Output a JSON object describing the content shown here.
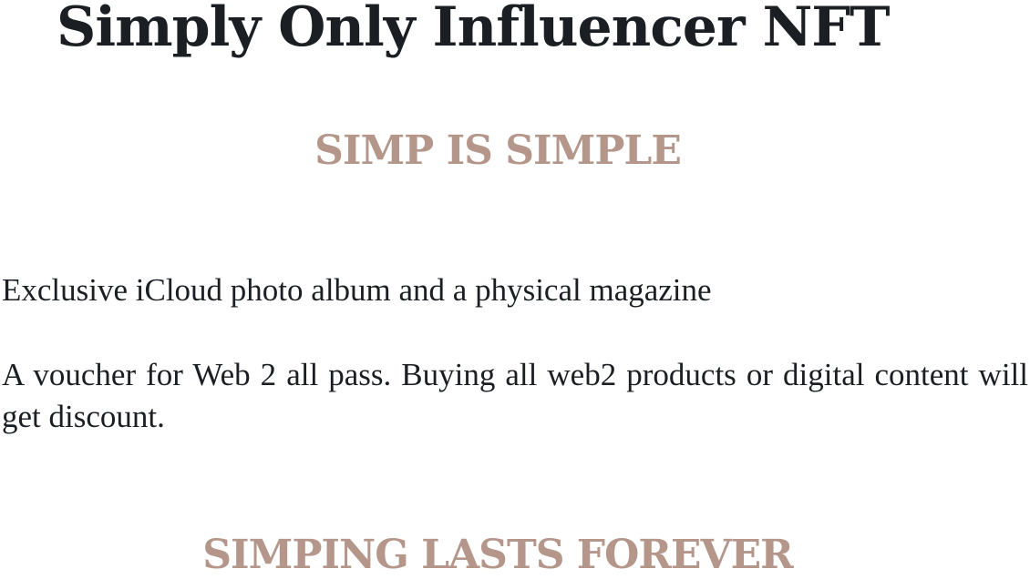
{
  "header": {
    "title": "Simply Only Influencer NFT"
  },
  "main": {
    "tagline": "SIMP IS SIMPLE",
    "benefits": [
      "Exclusive iCloud photo album and a physical magazine",
      "A voucher for Web 2 all pass. Buying all web2 products or digital content will get discount."
    ],
    "footer_tagline": "SIMPING LASTS FOREVER"
  },
  "colors": {
    "text": "#1b1f24",
    "accent": "#b5968a",
    "background": "#ffffff"
  }
}
